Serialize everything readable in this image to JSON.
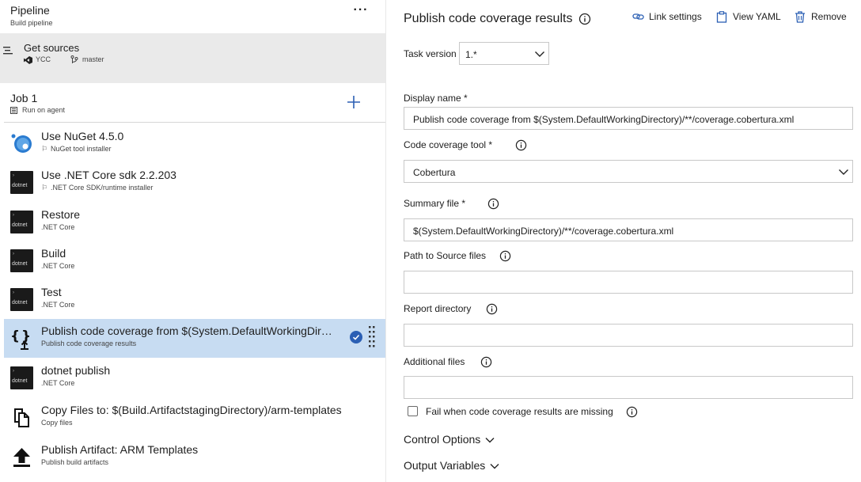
{
  "pipeline": {
    "title": "Pipeline",
    "subtitle": "Build pipeline",
    "more_label": "···"
  },
  "get_sources": {
    "title": "Get sources",
    "repo": "YCC",
    "branch": "master"
  },
  "job": {
    "title": "Job 1",
    "subtitle": "Run on agent"
  },
  "tasks": [
    {
      "title": "Use NuGet 4.5.0",
      "subtitle": "NuGet tool installer",
      "icon": "nuget-icon",
      "flag": true
    },
    {
      "title": "Use .NET Core sdk 2.2.203",
      "subtitle": ".NET Core SDK/runtime installer",
      "icon": "dotnet-icon",
      "flag": true
    },
    {
      "title": "Restore",
      "subtitle": ".NET Core",
      "icon": "dotnet-icon"
    },
    {
      "title": "Build",
      "subtitle": ".NET Core",
      "icon": "dotnet-icon"
    },
    {
      "title": "Test",
      "subtitle": ".NET Core",
      "icon": "dotnet-icon"
    },
    {
      "title": "Publish code coverage from $(System.DefaultWorkingDirectory)/**/coverage.cobertura.xml",
      "subtitle": "Publish code coverage results",
      "icon": "braces-upload-icon",
      "selected": true
    },
    {
      "title": "dotnet publish",
      "subtitle": ".NET Core",
      "icon": "dotnet-icon"
    },
    {
      "title": "Copy Files to: $(Build.ArtifactstagingDirectory)/arm-templates",
      "subtitle": "Copy files",
      "icon": "copy-files-icon"
    },
    {
      "title": "Publish Artifact: ARM Templates",
      "subtitle": "Publish build artifacts",
      "icon": "upload-arrow-icon"
    }
  ],
  "dotnet_logo_text": "dotnet",
  "detail": {
    "title": "Publish code coverage results",
    "link_settings": "Link settings",
    "view_yaml": "View YAML",
    "remove": "Remove",
    "task_version_label": "Task version",
    "task_version_value": "1.*",
    "display_name_label": "Display name *",
    "display_name_value": "Publish code coverage from $(System.DefaultWorkingDirectory)/**/coverage.cobertura.xml",
    "coverage_tool_label": "Code coverage tool *",
    "coverage_tool_value": "Cobertura",
    "summary_file_label": "Summary file *",
    "summary_file_value": "$(System.DefaultWorkingDirectory)/**/coverage.cobertura.xml",
    "path_source_label": "Path to Source files",
    "path_source_value": "",
    "report_dir_label": "Report directory",
    "report_dir_value": "",
    "additional_files_label": "Additional files",
    "additional_files_value": "",
    "fail_label": "Fail when code coverage results are missing",
    "fail_checked": false,
    "control_options": "Control Options",
    "output_variables": "Output Variables"
  },
  "colors": {
    "selected_bg": "#c7dcf2",
    "accent": "#2b5fb4",
    "sources_bg": "#eaeaea"
  }
}
